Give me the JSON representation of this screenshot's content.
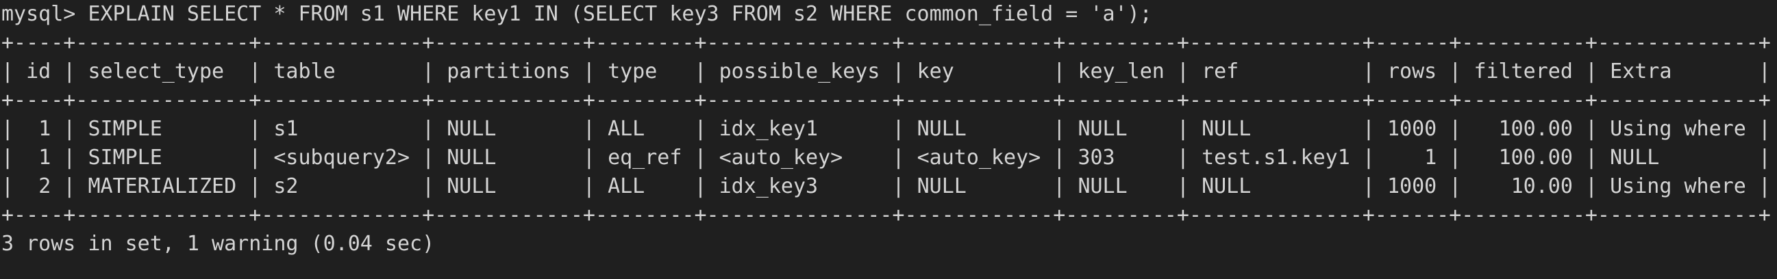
{
  "terminal": {
    "prompt": "mysql> ",
    "command": "EXPLAIN SELECT * FROM s1 WHERE key1 IN (SELECT key3 FROM s2 WHERE common_field = 'a');",
    "footer": "3 rows in set, 1 warning (0.04 sec)"
  },
  "table": {
    "columns": [
      {
        "name": "id",
        "align": "right"
      },
      {
        "name": "select_type",
        "align": "left"
      },
      {
        "name": "table",
        "align": "left"
      },
      {
        "name": "partitions",
        "align": "left"
      },
      {
        "name": "type",
        "align": "left"
      },
      {
        "name": "possible_keys",
        "align": "left"
      },
      {
        "name": "key",
        "align": "left"
      },
      {
        "name": "key_len",
        "align": "left"
      },
      {
        "name": "ref",
        "align": "left"
      },
      {
        "name": "rows",
        "align": "right"
      },
      {
        "name": "filtered",
        "align": "right"
      },
      {
        "name": "Extra",
        "align": "left"
      }
    ],
    "rows": [
      [
        "1",
        "SIMPLE",
        "s1",
        "NULL",
        "ALL",
        "idx_key1",
        "NULL",
        "NULL",
        "NULL",
        "1000",
        "100.00",
        "Using where"
      ],
      [
        "1",
        "SIMPLE",
        "<subquery2>",
        "NULL",
        "eq_ref",
        "<auto_key>",
        "<auto_key>",
        "303",
        "test.s1.key1",
        "1",
        "100.00",
        "NULL"
      ],
      [
        "2",
        "MATERIALIZED",
        "s2",
        "NULL",
        "ALL",
        "idx_key3",
        "NULL",
        "NULL",
        "NULL",
        "1000",
        "10.00",
        "Using where"
      ]
    ]
  }
}
